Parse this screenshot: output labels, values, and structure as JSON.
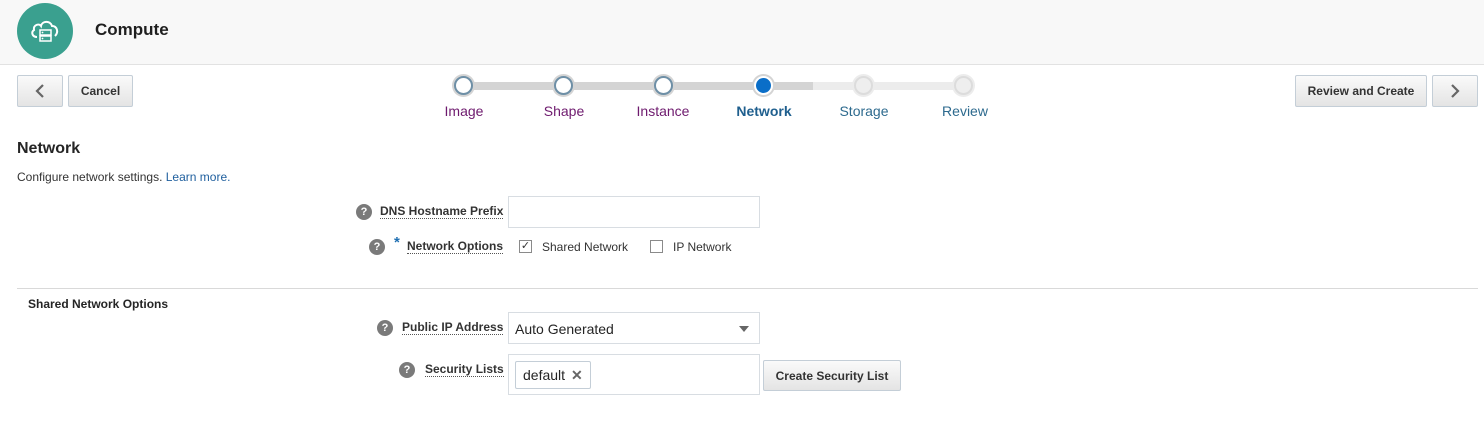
{
  "header": {
    "app_title": "Compute",
    "app_icon": "cloud-server-icon",
    "accent_color": "#3aa08f"
  },
  "toolbar": {
    "back_icon": "chevron-left-icon",
    "cancel_label": "Cancel",
    "review_create_label": "Review and Create",
    "next_icon": "chevron-right-icon"
  },
  "train": {
    "steps": [
      {
        "label": "Image",
        "state": "visited"
      },
      {
        "label": "Shape",
        "state": "visited"
      },
      {
        "label": "Instance",
        "state": "visited"
      },
      {
        "label": "Network",
        "state": "current"
      },
      {
        "label": "Storage",
        "state": "unvisited"
      },
      {
        "label": "Review",
        "state": "unvisited"
      }
    ]
  },
  "section": {
    "title": "Network",
    "description": "Configure network settings.",
    "learn_more": "Learn more."
  },
  "fields": {
    "help_glyph": "?",
    "required_marker": "*",
    "dns_prefix": {
      "label": "DNS Hostname Prefix",
      "value": ""
    },
    "network_options": {
      "label": "Network Options",
      "check_glyph": "✓",
      "shared": {
        "label": "Shared Network",
        "checked": true
      },
      "ip": {
        "label": "IP Network",
        "checked": false
      }
    }
  },
  "shared_network": {
    "title": "Shared Network Options",
    "public_ip": {
      "label": "Public IP Address",
      "value": "Auto Generated"
    },
    "security_lists": {
      "label": "Security Lists",
      "tags": [
        "default"
      ],
      "remove_glyph": "✕",
      "create_label": "Create Security List"
    }
  }
}
